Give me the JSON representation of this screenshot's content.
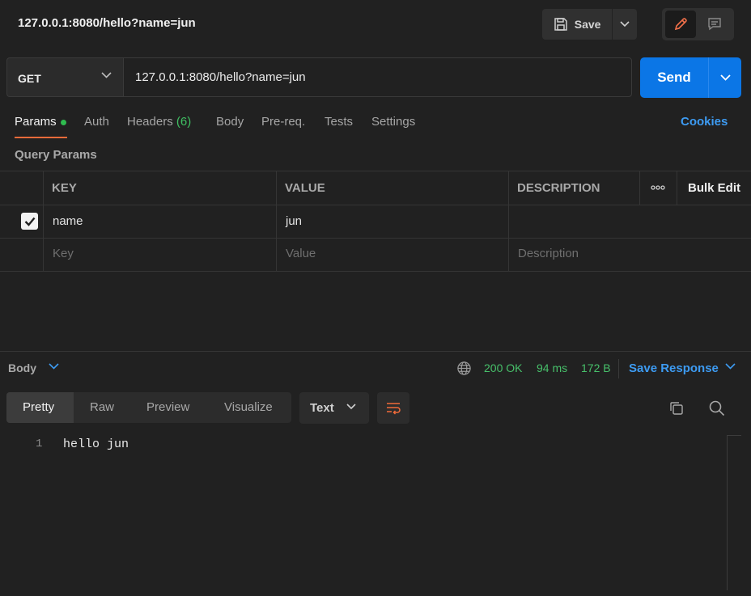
{
  "header": {
    "title": "127.0.0.1:8080/hello?name=jun",
    "save_label": "Save"
  },
  "request": {
    "method": "GET",
    "url": "127.0.0.1:8080/hello?name=jun",
    "send_label": "Send"
  },
  "tabs": {
    "params": "Params",
    "auth": "Auth",
    "headers": "Headers",
    "headers_count": "(6)",
    "body": "Body",
    "prereq": "Pre-req.",
    "tests": "Tests",
    "settings": "Settings",
    "cookies": "Cookies"
  },
  "query_params": {
    "title": "Query Params",
    "columns": {
      "key": "KEY",
      "value": "VALUE",
      "description": "DESCRIPTION",
      "bulk_edit": "Bulk Edit"
    },
    "rows": [
      {
        "checked": true,
        "key": "name",
        "value": "jun",
        "description": ""
      }
    ],
    "placeholders": {
      "key": "Key",
      "value": "Value",
      "description": "Description"
    }
  },
  "response": {
    "section_label": "Body",
    "status": "200 OK",
    "time": "94 ms",
    "size": "172 B",
    "save_label": "Save Response",
    "view_tabs": [
      "Pretty",
      "Raw",
      "Preview",
      "Visualize"
    ],
    "active_view": "Pretty",
    "format": "Text",
    "line_number": "1",
    "content": "hello jun"
  },
  "colors": {
    "accent": "#0b76e6",
    "link": "#3d9bf2",
    "success": "#47c06a",
    "active_tab": "#f26b3a"
  },
  "icons": [
    "save-icon",
    "chevron-down-icon",
    "pencil-icon",
    "comment-icon",
    "checkbox-icon",
    "more-icon",
    "globe-icon",
    "wrap-icon",
    "copy-icon",
    "search-icon"
  ]
}
